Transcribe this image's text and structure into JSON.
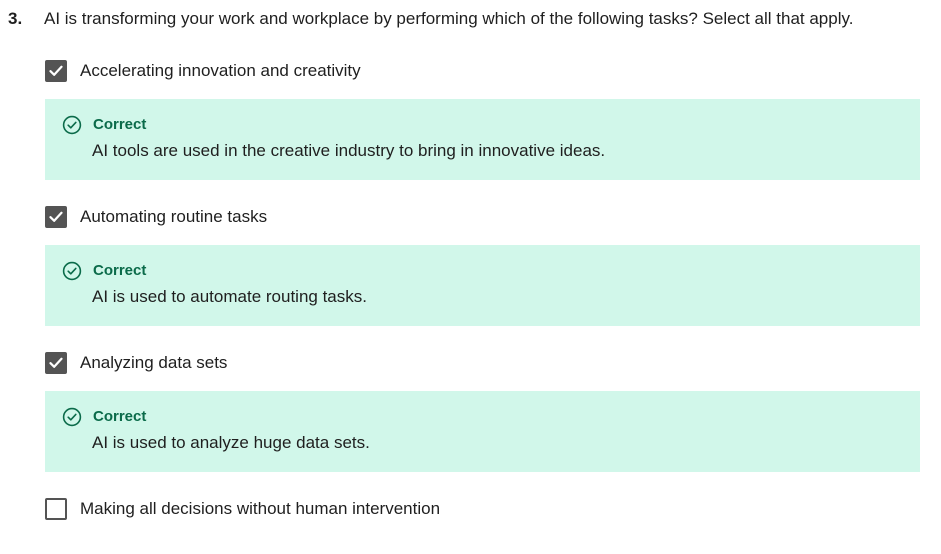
{
  "question": {
    "number": "3.",
    "text": "AI is transforming your work and workplace by performing which of the following tasks? Select all that apply."
  },
  "options": [
    {
      "label": "Accelerating innovation and creativity",
      "checked": true,
      "feedback": {
        "status": "Correct",
        "explanation": "AI tools are used in the creative industry to bring in innovative ideas."
      }
    },
    {
      "label": "Automating routine tasks",
      "checked": true,
      "feedback": {
        "status": "Correct",
        "explanation": "AI is used to automate routing tasks."
      }
    },
    {
      "label": "Analyzing data sets",
      "checked": true,
      "feedback": {
        "status": "Correct",
        "explanation": "AI is used to analyze huge data sets."
      }
    },
    {
      "label": "Making all decisions without human intervention",
      "checked": false
    }
  ],
  "icons": {
    "checkmark": "checkmark-icon",
    "correct": "check-circle-icon"
  },
  "colors": {
    "feedback_background": "#d1f7ea",
    "correct_text": "#0b6b4a",
    "checkbox": "#545454"
  }
}
